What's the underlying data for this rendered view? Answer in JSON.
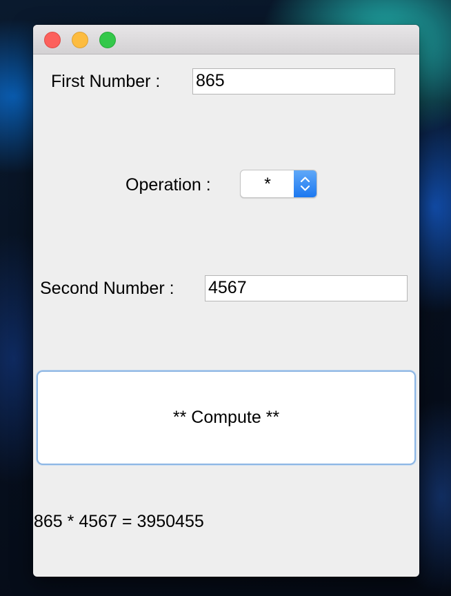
{
  "window": {
    "controls": [
      "close",
      "minimize",
      "zoom"
    ]
  },
  "form": {
    "first_number_label": "First Number :",
    "first_number_value": "865",
    "operation_label": "Operation :",
    "operation_value": "*",
    "second_number_label": "Second Number :",
    "second_number_value": "4567",
    "compute_label": "** Compute **",
    "result_text": "865 * 4567 = 3950455"
  },
  "colors": {
    "close": "#fc605c",
    "minimize": "#fdbc40",
    "zoom": "#34c84a",
    "select_accent": "#1c78f0",
    "button_focus_ring": "#8db6e4"
  },
  "icons": {
    "select_arrows": "chevron-up-down-icon"
  }
}
